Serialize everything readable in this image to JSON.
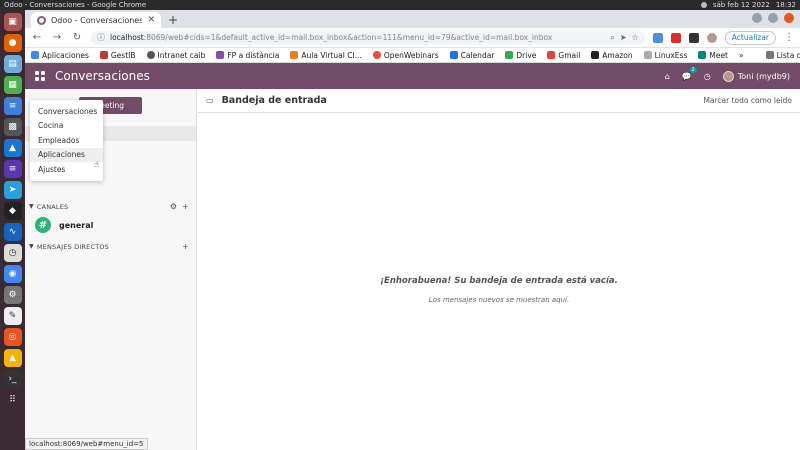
{
  "os": {
    "window_title": "Odoo - Conversaciones - Google Chrome",
    "clock": "sáb feb 12 2022",
    "time": "18:32"
  },
  "dock": {
    "icons": [
      "trash-icon",
      "firefox-icon",
      "files-icon",
      "calc-icon",
      "writer-icon",
      "calculator-icon",
      "monitor-icon",
      "terminal-icon",
      "telegram-icon",
      "inkscape-icon",
      "wave-icon",
      "clock-icon",
      "chrome-icon",
      "settings-icon",
      "text-editor-icon",
      "ubuntu-icon",
      "vlc-icon",
      "console-icon",
      "apps-grid-icon"
    ]
  },
  "browser": {
    "tab_title": "Odoo - Conversaciones",
    "url_host": "localhost",
    "url_path": ":8069/web#cids=1&default_active_id=mail.box_inbox&action=111&menu_id=79&active_id=mail.box_inbox",
    "update_label": "Actualizar",
    "bookmarks": [
      "Aplicaciones",
      "GestIB",
      "Intranet caib",
      "FP a distància",
      "Aula Virtual CI...",
      "OpenWebinars",
      "Calendar",
      "Drive",
      "Gmail",
      "Amazon",
      "LinuxEss",
      "Meet"
    ],
    "bookmarks_more": "»",
    "reading_list": "Lista de lectura",
    "status_url": "localhost:8069/web#menu_id=5"
  },
  "odoo": {
    "app_name": "Conversaciones",
    "chat_count": "2",
    "user_name": "Toni (mydb9)",
    "start_meeting_label": "a meeting",
    "mailbox_label": "da",
    "channels_header": "CANALES",
    "channel_name": "general",
    "direct_header": "MENSAJES DIRECTOS",
    "apps_menu": [
      "Conversaciones",
      "Cocina",
      "Empleados",
      "Aplicaciones",
      "Ajustes"
    ],
    "content_title": "Bandeja de entrada",
    "mark_all_read": "Marcar todo como leido",
    "empty_title": "¡Enhorabuena! Su bandeja de entrada está vacía.",
    "empty_subtitle": "Los mensajes nuevos se muestran aquí."
  },
  "colors": {
    "odoo_purple": "#714b67",
    "channel_green": "#2fb27a"
  }
}
